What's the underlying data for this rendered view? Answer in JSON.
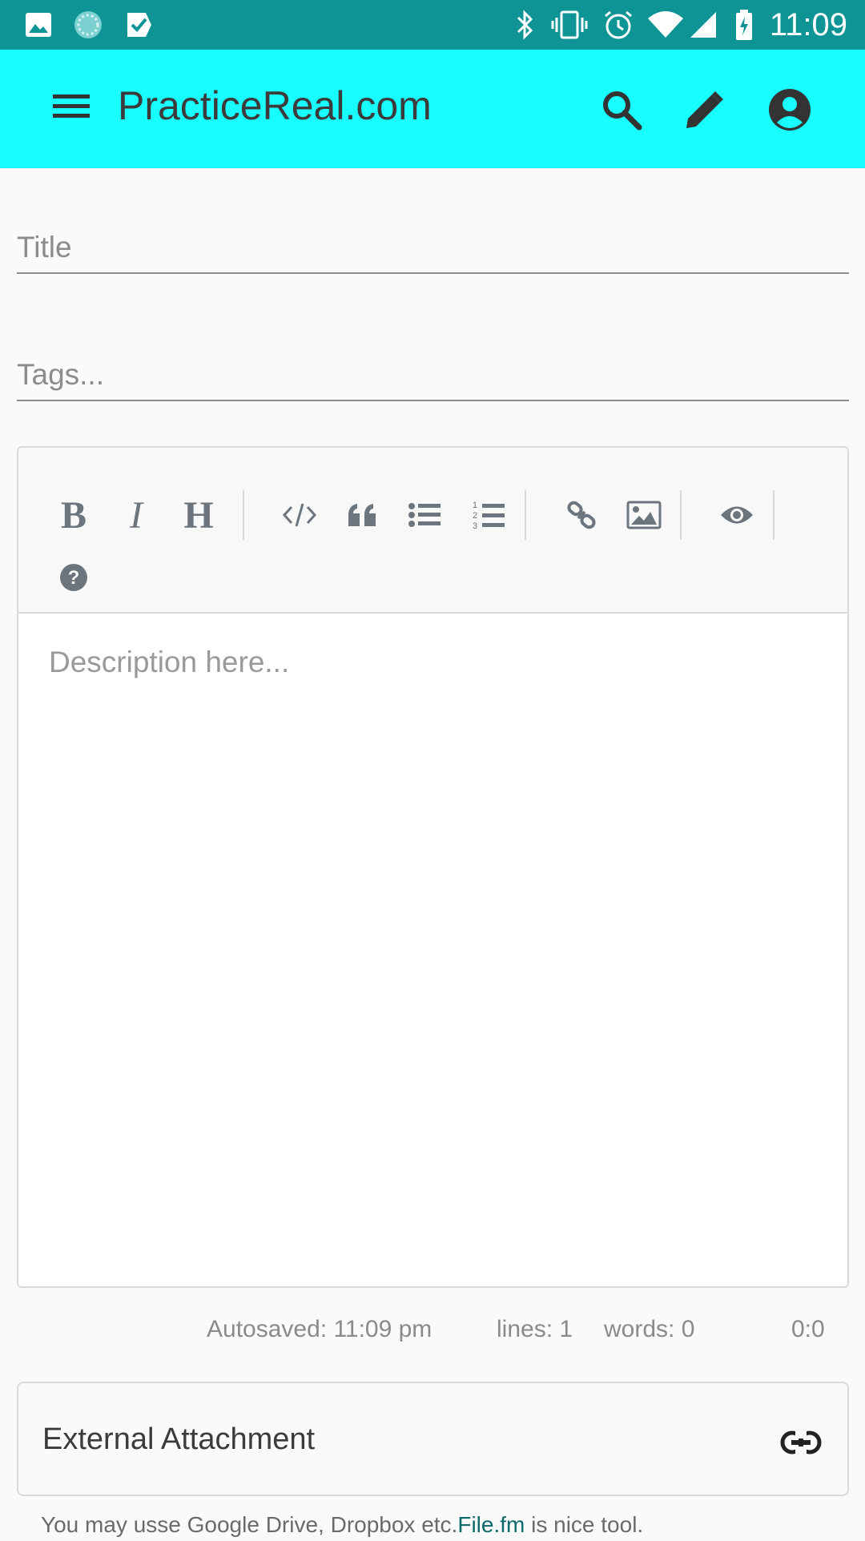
{
  "status_bar": {
    "time": "11:09",
    "icons": [
      "gallery-icon",
      "loading-circle-icon",
      "tasks-check-icon",
      "bluetooth-icon",
      "vibrate-icon",
      "alarm-icon",
      "wifi-icon",
      "signal-icon",
      "battery-charging-icon"
    ]
  },
  "app_bar": {
    "title": "PracticeReal.com",
    "icons": [
      "menu-icon",
      "search-icon",
      "edit-pencil-icon",
      "account-circle-icon"
    ],
    "background": "#17ffff"
  },
  "form": {
    "title_placeholder": "Title",
    "tags_placeholder": "Tags...",
    "description_placeholder": "Description here..."
  },
  "toolbar": {
    "bold": "B",
    "italic": "I",
    "heading": "H",
    "icons": [
      "bold-icon",
      "italic-icon",
      "heading-icon",
      "code-icon",
      "quote-icon",
      "bullet-list-icon",
      "numbered-list-icon",
      "link-icon",
      "image-icon",
      "preview-eye-icon",
      "help-icon"
    ]
  },
  "status": {
    "autosaved": "Autosaved: 11:09 pm",
    "lines": "lines: 1",
    "words": "words: 0",
    "cursor": "0:0"
  },
  "attachment": {
    "label": "External Attachment",
    "icon": "link-icon"
  },
  "note": {
    "prefix": "You may usse Google Drive, Dropbox etc.",
    "link_text": "File.fm",
    "suffix": " is nice tool."
  }
}
